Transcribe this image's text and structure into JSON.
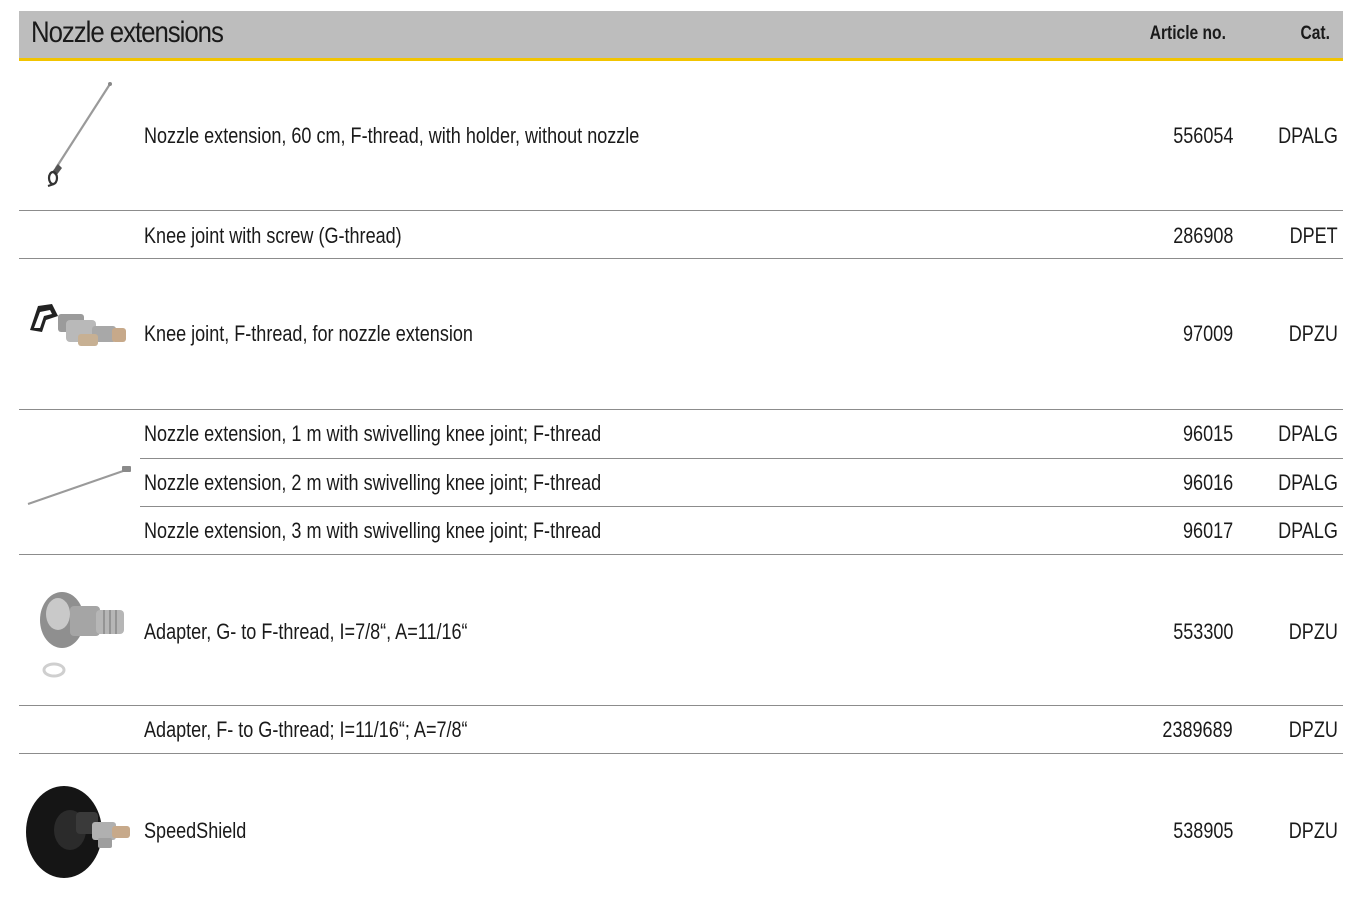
{
  "header": {
    "title": "Nozzle extensions",
    "article_label": "Article no.",
    "cat_label": "Cat."
  },
  "colors": {
    "header_bg": "#bdbdbd",
    "header_accent": "#f2c400",
    "divider": "#8c8c8c"
  },
  "rows": [
    {
      "description": "Nozzle extension, 60 cm, F-thread, with holder, without nozzle",
      "article": "556054",
      "cat": "DPALG",
      "image": "nozzle-extension-holder-image"
    },
    {
      "description": "Knee joint with screw (G-thread)",
      "article": "286908",
      "cat": "DPET",
      "image": ""
    },
    {
      "description": "Knee joint, F-thread, for nozzle extension",
      "article": "97009",
      "cat": "DPZU",
      "image": "knee-joint-image"
    },
    {
      "description": "Nozzle extension, 1 m with swivelling knee joint; F-thread",
      "article": "96015",
      "cat": "DPALG",
      "image": "nozzle-extension-rod-image"
    },
    {
      "description": "Nozzle extension, 2 m with swivelling knee joint; F-thread",
      "article": "96016",
      "cat": "DPALG",
      "image": ""
    },
    {
      "description": "Nozzle extension, 3 m with swivelling knee joint; F-thread",
      "article": "96017",
      "cat": "DPALG",
      "image": ""
    },
    {
      "description": "Adapter, G- to F-thread, I=7/8“, A=11/16“",
      "article": "553300",
      "cat": "DPZU",
      "image": "adapter-image"
    },
    {
      "description": "Adapter, F- to G-thread; I=11/16“; A=7/8“",
      "article": "2389689",
      "cat": "DPZU",
      "image": ""
    },
    {
      "description": "SpeedShield",
      "article": "538905",
      "cat": "DPZU",
      "image": "speedshield-image"
    }
  ]
}
